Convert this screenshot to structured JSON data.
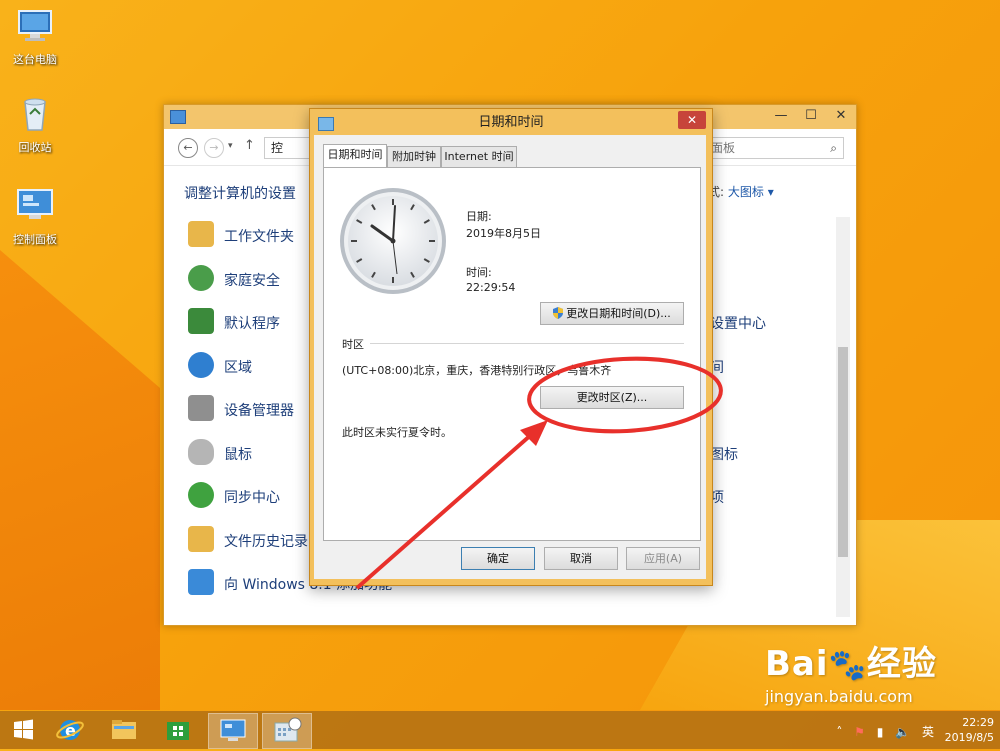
{
  "desktop": {
    "icons": [
      {
        "label": "这台电脑",
        "icon": "computer-icon"
      },
      {
        "label": "回收站",
        "icon": "recycle-bin-icon"
      },
      {
        "label": "控制面板",
        "icon": "control-panel-icon"
      }
    ]
  },
  "control_panel": {
    "address_text": "控",
    "search_placeholder": "面板",
    "heading": "调整计算机的设置",
    "view_by_suffix": "式:",
    "view_by_value": "大图标 ▾",
    "items_left": [
      {
        "label": "工作文件夹",
        "icon": "folder-icon",
        "color": "#e8b64a"
      },
      {
        "label": "家庭安全",
        "icon": "family-safety-icon",
        "color": "#4a9d4a"
      },
      {
        "label": "默认程序",
        "icon": "default-programs-icon",
        "color": "#3b8a3b"
      },
      {
        "label": "区域",
        "icon": "globe-clock-icon",
        "color": "#2f7fd0"
      },
      {
        "label": "设备管理器",
        "icon": "device-manager-icon",
        "color": "#8f8f8f"
      },
      {
        "label": "鼠标",
        "icon": "mouse-icon",
        "color": "#b5b5b5"
      },
      {
        "label": "同步中心",
        "icon": "sync-center-icon",
        "color": "#3fa23f"
      },
      {
        "label": "文件历史记录",
        "icon": "file-history-icon",
        "color": "#e8b64a"
      },
      {
        "label": "向 Windows 8.1 添加功能",
        "icon": "add-features-icon",
        "color": "#3a8ad8"
      }
    ],
    "items_right": [
      "设置中心",
      "间",
      "图标",
      "项"
    ]
  },
  "dialog": {
    "title": "日期和时间",
    "tabs": [
      "日期和时间",
      "附加时钟",
      "Internet 时间"
    ],
    "date_label": "日期:",
    "date_value": "2019年8月5日",
    "time_label": "时间:",
    "time_value": "22:29:54",
    "change_datetime_button": "更改日期和时间(D)...",
    "timezone_section": "时区",
    "timezone_value": "(UTC+08:00)北京，重庆，香港特别行政区，乌鲁木齐",
    "change_timezone_button": "更改时区(Z)...",
    "dst_note": "此时区未实行夏令时。",
    "ok": "确定",
    "cancel": "取消",
    "apply": "应用(A)"
  },
  "taskbar": {
    "apps": [
      {
        "icon": "windows-start-icon"
      },
      {
        "icon": "internet-explorer-icon"
      },
      {
        "icon": "file-explorer-icon"
      },
      {
        "icon": "store-icon"
      },
      {
        "icon": "control-panel-task-icon",
        "active": true
      },
      {
        "icon": "date-time-task-icon",
        "active": true
      }
    ],
    "tray_lang": "英",
    "clock_time": "22:29",
    "clock_date": "2019/8/5"
  },
  "watermark": {
    "brand": "Bai",
    "brand_cn": "经验",
    "url": "jingyan.baidu.com"
  }
}
